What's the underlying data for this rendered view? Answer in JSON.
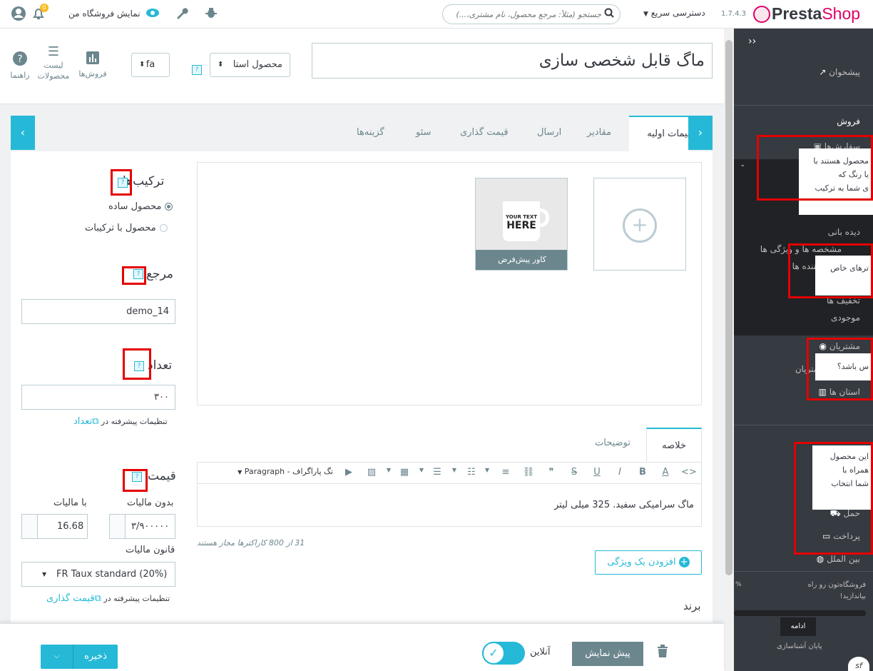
{
  "header": {
    "notifications_count": "0",
    "view_store": "نمایش فروشگاه من",
    "search_placeholder": "جستجو (مثلاً: مرجع محصول، نام مشتری،...)",
    "quick_access": "دسترسی سریع",
    "version": "1.7.4.3",
    "logo_left": "Presta",
    "logo_right": "Shop"
  },
  "product": {
    "name": "ماگ قابل شخصی سازی",
    "type": "محصول استا",
    "language": "fa"
  },
  "tools": {
    "sales": "فروش‌ها",
    "product_list_1": "لیست",
    "product_list_2": "محصولات",
    "help": "راهنما"
  },
  "tabs": [
    {
      "label": "تنظیمات اولیه"
    },
    {
      "label": "مقادیر"
    },
    {
      "label": "ارسال"
    },
    {
      "label": "قیمت گذاری"
    },
    {
      "label": "سئو"
    },
    {
      "label": "گزینه‌ها"
    }
  ],
  "left_form": {
    "combinations_title": "ترکیب‌ها",
    "simple_product": "محصول ساده",
    "with_combinations": "محصول با ترکیبات",
    "reference_title": "مرجع",
    "reference_value": "demo_14",
    "quantity_title": "تعداد",
    "quantity_value": "۳۰۰",
    "advanced_settings_in": "تنظیمات پیشرفته در",
    "quantity_link": "تعداد",
    "price_title": "قیمت",
    "without_tax": "بدون مالیات",
    "with_tax": "با مالیات",
    "price_excl": "۳/۹۰۰۰۰۰",
    "price_incl": "16.68",
    "tax_rule_label": "قانون مالیات",
    "tax_rule_value": "FR Taux standard (20%)",
    "pricing_link": "قیمت گذاری"
  },
  "images": {
    "cover_caption": "کاور پیش‌فرض",
    "mug_line1": "YOUR TEXT",
    "mug_line2": "HERE",
    "add_symbol": "+"
  },
  "description": {
    "tab_summary": "خلاصه",
    "tab_description": "توضیحات",
    "paragraph_label": "تگ پاراگراف - Paragraph",
    "text": "ماگ سرامیکی سفید. 325 میلی لیتر",
    "char_count": "31 از 800 کاراکترها مجاز هستند",
    "add_feature": "افزودن یک ویژگی",
    "brand_title": "برند"
  },
  "footer": {
    "save": "ذخیره",
    "preview": "پیش نمایش",
    "online": "آنلاین"
  },
  "sidebar": {
    "dashboard": "پیشخوان",
    "sell": "فروش",
    "orders": "سفارش‌ها",
    "monitoring": "دیده بانی",
    "attributes": "مشخصه ها و ویژگی ها",
    "suppliers": "تامین کننده ها",
    "discounts": "تخفیف ها",
    "stock": "موجودی",
    "customers": "مشتریان",
    "customers_sub": "مشتریان",
    "stats": "استان ها",
    "shipping": "حمل",
    "payment": "پرداخت",
    "international": "بین الملل",
    "onboarding_text_1": "فروشگاه‌تون رو راه",
    "onboarding_text_2": "بیاندازید!",
    "onboarding_percent": "%",
    "continue": "ادامه",
    "end_onboarding": "پایان آشناسازی",
    "tooltip1_l1": "محصول هستند با",
    "tooltip1_l2": "یا رنگ که",
    "tooltip1_l3": "ی شما به ترکیب",
    "tooltip2_l1": "ترهای خاص",
    "tooltip3_l1": "س باشد؟",
    "tooltip4_l1": "این محصول",
    "tooltip4_l2": "همراه با",
    "tooltip4_l3": "شما انتخاب"
  },
  "colors": {
    "accent": "#25b9d7",
    "brand": "#df0067",
    "sidebar": "#363a41",
    "highlight": "#e40000"
  }
}
